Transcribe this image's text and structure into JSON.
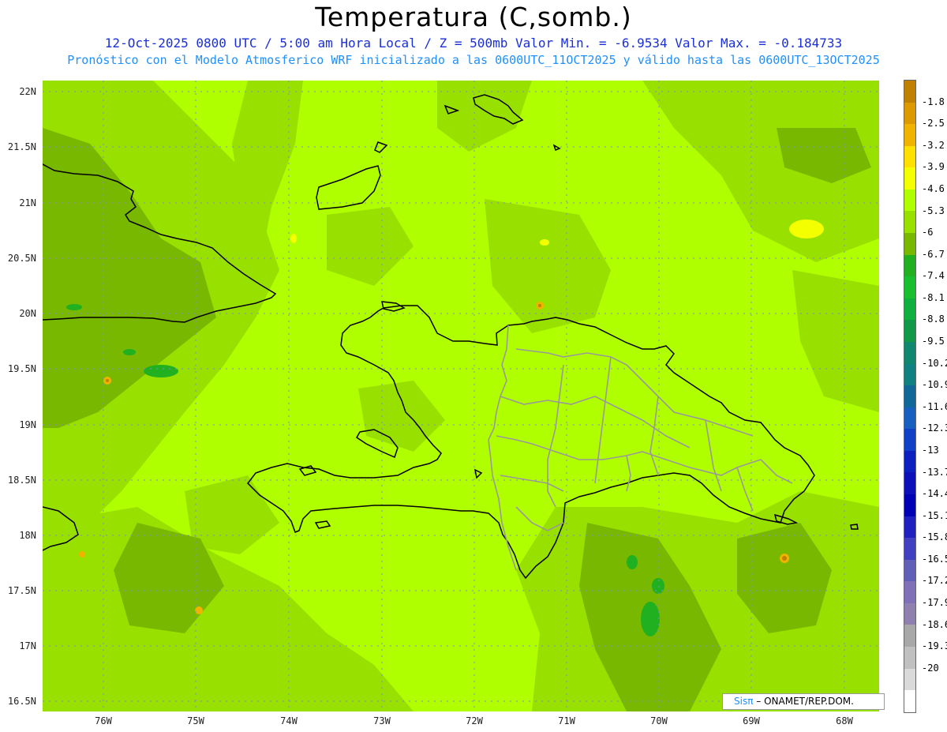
{
  "title": "Temperatura (C,somb.)",
  "subtitle_line1": "12-Oct-2025  0800 UTC / 5:00 am Hora Local / Z = 500mb  Valor Min. = -6.9534  Valor Max. = -0.184733",
  "subtitle_line2": "Pronóstico con el Modelo Atmosferico WRF inicializado a las 0600UTC_11OCT2025 y válido hasta las  0600UTC_13OCT2025",
  "lat_labels": [
    "22N",
    "21.5N",
    "21N",
    "20.5N",
    "20N",
    "19.5N",
    "19N",
    "18.5N",
    "18N",
    "17.5N",
    "17N",
    "16.5N"
  ],
  "lon_labels": [
    "76W",
    "75W",
    "74W",
    "73W",
    "72W",
    "71W",
    "70W",
    "69W",
    "68W"
  ],
  "colorbar": {
    "labels": [
      "-1.8",
      "-2.5",
      "-3.2",
      "-3.9",
      "-4.6",
      "-5.3",
      "-6",
      "-6.7",
      "-7.4",
      "-8.1",
      "-8.8",
      "-9.5",
      "-10.2",
      "-10.9",
      "-11.6",
      "-12.3",
      "-13",
      "-13.7",
      "-14.4",
      "-15.1",
      "-15.8",
      "-16.5",
      "-17.2",
      "-17.9",
      "-18.6",
      "-19.3",
      "-20"
    ],
    "colors": [
      "#c08000",
      "#dc9a00",
      "#f0b400",
      "#ffe000",
      "#f4ff00",
      "#b0ff00",
      "#98e000",
      "#78b800",
      "#20b020",
      "#18c030",
      "#10b040",
      "#109a48",
      "#108870",
      "#108080",
      "#106898",
      "#1860c0",
      "#1040c8",
      "#0c20c0",
      "#0c10b8",
      "#0000b4",
      "#2020c0",
      "#4040c0",
      "#6060b8",
      "#8070b8",
      "#9080b0",
      "#a8a8a8",
      "#c0c0c0",
      "#dadada",
      "#ffffff"
    ]
  },
  "credit": {
    "brand": "Sisπ",
    "text": "– ONAMET/REP.DOM."
  }
}
